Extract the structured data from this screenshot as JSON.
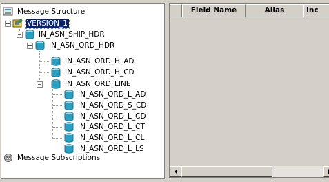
{
  "tree": {
    "root_label": "Message Structure",
    "version_label": "VERSION_1",
    "nodes": [
      "IN_ASN_SHIP_HDR",
      "IN_ASN_ORD_HDR",
      "IN_ASN_ORD_H_AD",
      "IN_ASN_ORD_H_CD",
      "IN_ASN_ORD_LINE",
      "IN_ASN_ORD_L_AD",
      "IN_ASN_ORD_S_CD",
      "IN_ASN_ORD_L_CD",
      "IN_ASN_ORD_L_CT",
      "IN_ASN_ORD_L_CL",
      "IN_ASN_ORD_L_LS"
    ],
    "subscriptions_label": "Message Subscriptions"
  },
  "grid": {
    "columns": [
      "",
      "Field Name",
      "Alias",
      "Inc"
    ]
  },
  "icons": {
    "root": "message-structure-icon",
    "version": "version-icon",
    "node": "database-cylinder-icon",
    "subscriptions": "message-subscriptions-icon"
  },
  "colors": {
    "selection": "#0a246a",
    "cylinder": "#2a9fc0"
  }
}
